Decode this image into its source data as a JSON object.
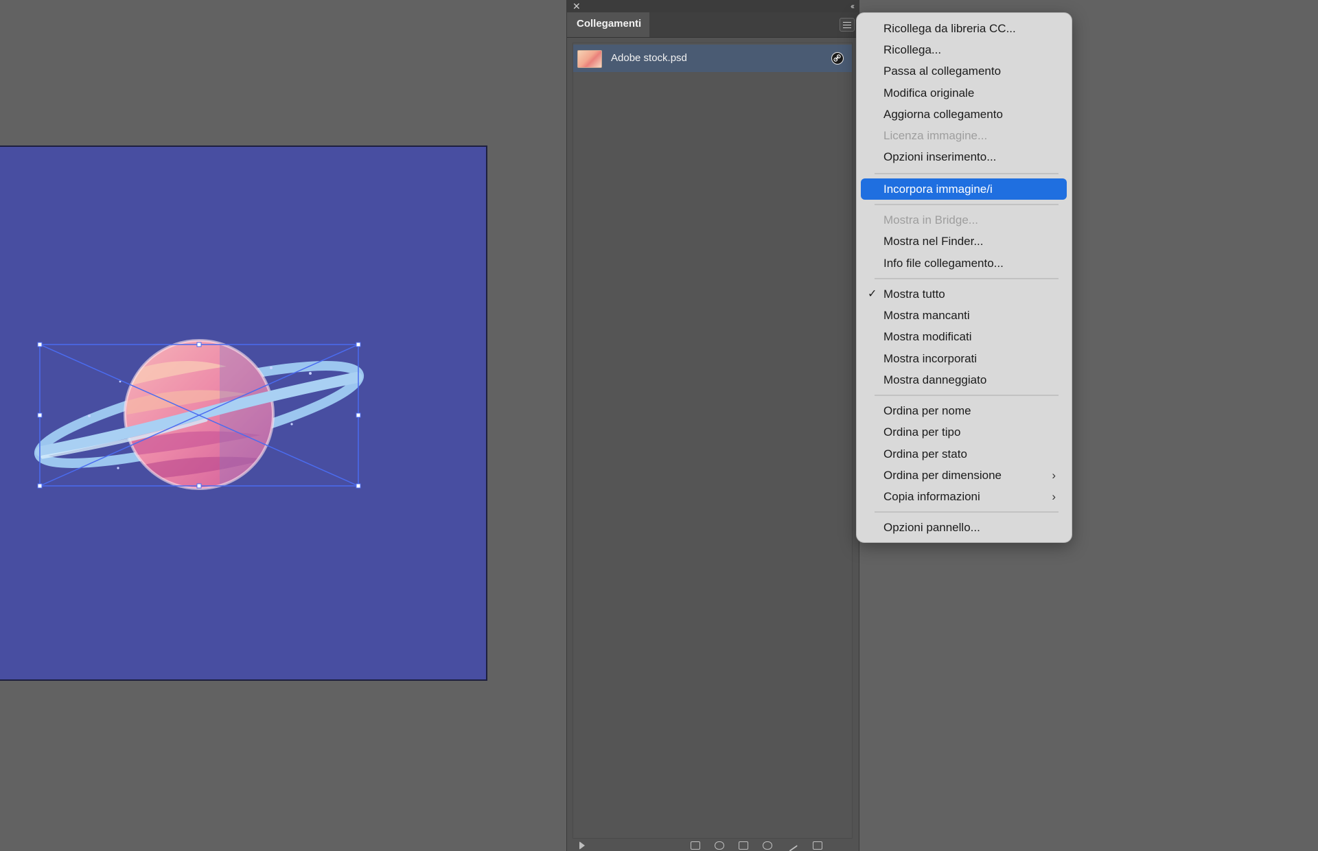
{
  "panel": {
    "title": "Collegamenti",
    "close_glyph": "✕",
    "collapse_glyph": "‹‹",
    "links": [
      {
        "name": "Adobe stock.psd",
        "status_icon": "link-icon"
      }
    ]
  },
  "menu": {
    "items": [
      {
        "label": "Ricollega da libreria CC...",
        "state": "normal"
      },
      {
        "label": "Ricollega...",
        "state": "normal"
      },
      {
        "label": "Passa al collegamento",
        "state": "normal"
      },
      {
        "label": "Modifica originale",
        "state": "normal"
      },
      {
        "label": "Aggiorna collegamento",
        "state": "normal"
      },
      {
        "label": "Licenza immagine...",
        "state": "disabled"
      },
      {
        "label": "Opzioni inserimento...",
        "state": "normal"
      },
      {
        "label": "Incorpora immagine/i",
        "state": "highlighted"
      },
      {
        "label": "Mostra in Bridge...",
        "state": "disabled"
      },
      {
        "label": "Mostra nel Finder...",
        "state": "normal"
      },
      {
        "label": "Info file collegamento...",
        "state": "normal"
      },
      {
        "label": "Mostra tutto",
        "state": "checked"
      },
      {
        "label": "Mostra mancanti",
        "state": "normal"
      },
      {
        "label": "Mostra modificati",
        "state": "normal"
      },
      {
        "label": "Mostra incorporati",
        "state": "normal"
      },
      {
        "label": "Mostra danneggiato",
        "state": "normal"
      },
      {
        "label": "Ordina per nome",
        "state": "normal"
      },
      {
        "label": "Ordina per tipo",
        "state": "normal"
      },
      {
        "label": "Ordina per stato",
        "state": "normal"
      },
      {
        "label": "Ordina per dimensione",
        "state": "submenu"
      },
      {
        "label": "Copia informazioni",
        "state": "submenu"
      },
      {
        "label": "Opzioni pannello...",
        "state": "normal"
      }
    ],
    "check_glyph": "✓",
    "submenu_glyph": "›"
  },
  "colors": {
    "canvas_bg": "#626262",
    "artboard": "#484ea1",
    "selection": "#4b6cf0",
    "menu_highlight": "#1f6fe0"
  }
}
